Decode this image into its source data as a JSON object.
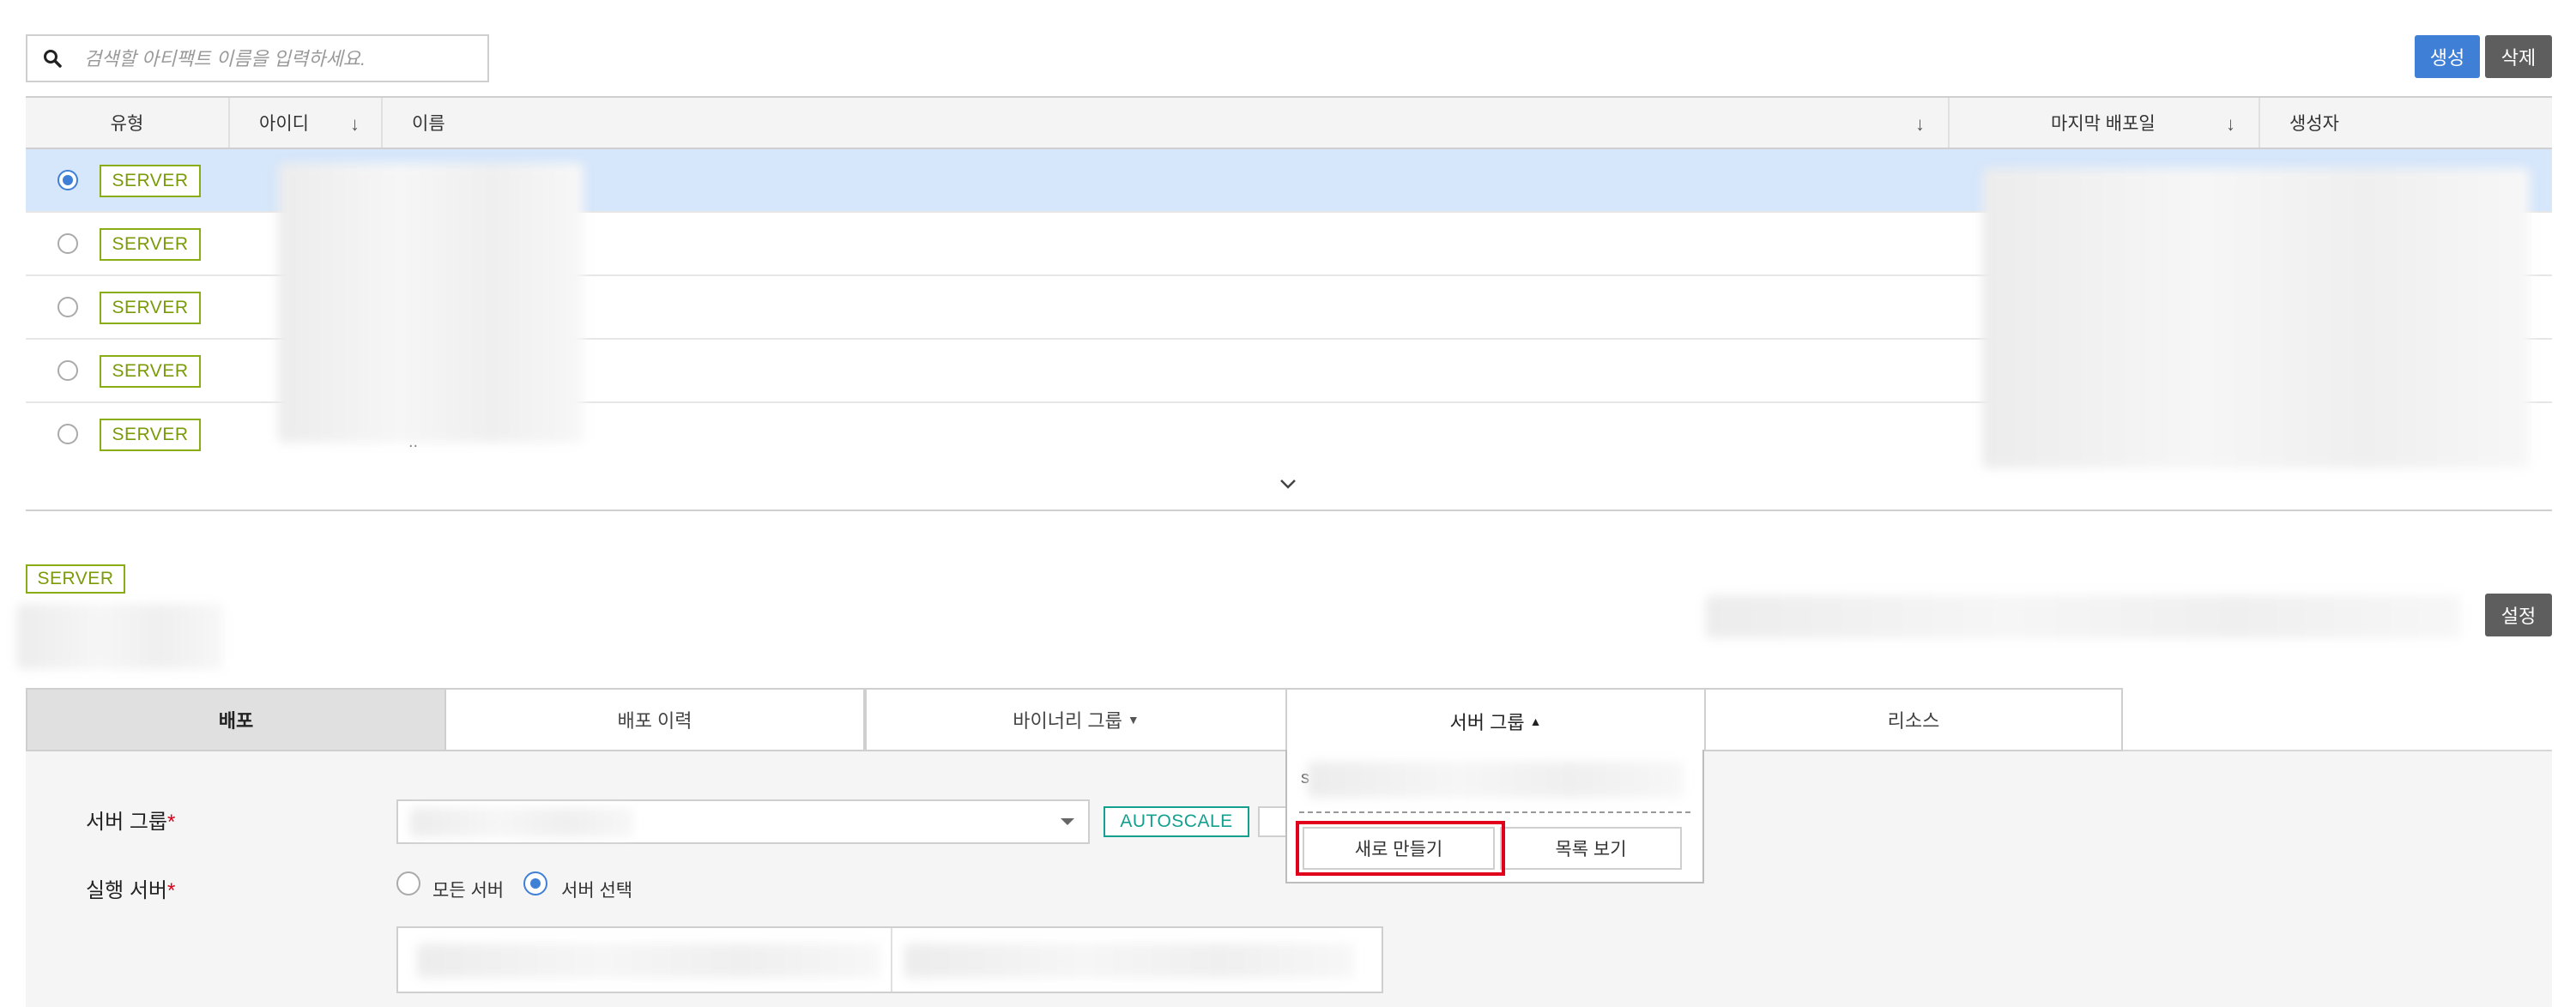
{
  "search": {
    "placeholder": "검색할 아티팩트 이름을 입력하세요."
  },
  "toolbar": {
    "create_label": "생성",
    "delete_label": "삭제"
  },
  "table": {
    "columns": {
      "type": "유형",
      "id": "아이디",
      "name": "이름",
      "last_deploy": "마지막 배포일",
      "creator": "생성자"
    },
    "rows": [
      {
        "type": "SERVER",
        "selected": true
      },
      {
        "type": "SERVER",
        "selected": false
      },
      {
        "type": "SERVER",
        "selected": false
      },
      {
        "type": "SERVER",
        "selected": false
      },
      {
        "type": "SERVER",
        "selected": false
      }
    ],
    "row5_name_fragment": ".."
  },
  "detail": {
    "type_badge": "SERVER",
    "settings_label": "설정"
  },
  "tabs": [
    {
      "label": "배포",
      "active": true
    },
    {
      "label": "배포 이력",
      "active": false
    },
    {
      "label": "바이너리 그룹",
      "active": false
    },
    {
      "label": "서버 그룹",
      "active": false
    },
    {
      "label": "리소스",
      "active": false
    }
  ],
  "dropdown": {
    "item_fragment": "s",
    "new_label": "새로 만들기",
    "list_label": "목록 보기"
  },
  "form": {
    "server_group_label": "서버 그룹",
    "exec_server_label": "실행 서버",
    "required_mark": "*",
    "autoscale_label": "AUTOSCALE",
    "radio_all": "모든 서버",
    "radio_select": "서버 선택",
    "selected_radio": "서버 선택"
  },
  "colors": {
    "primary": "#3f7fd6",
    "dark_button": "#5e5e5e",
    "badge_green": "#8aac15",
    "autoscale_teal": "#13a08e",
    "highlight_red": "#e0001b",
    "row_selected": "#d6e6fb"
  },
  "icons": {
    "search": "search-icon",
    "sort": "arrow-down-icon",
    "expand": "chevron-down-icon",
    "tab_caret_down": "caret-down-icon",
    "tab_caret_up": "caret-up-icon",
    "select_caret": "caret-down-icon"
  }
}
